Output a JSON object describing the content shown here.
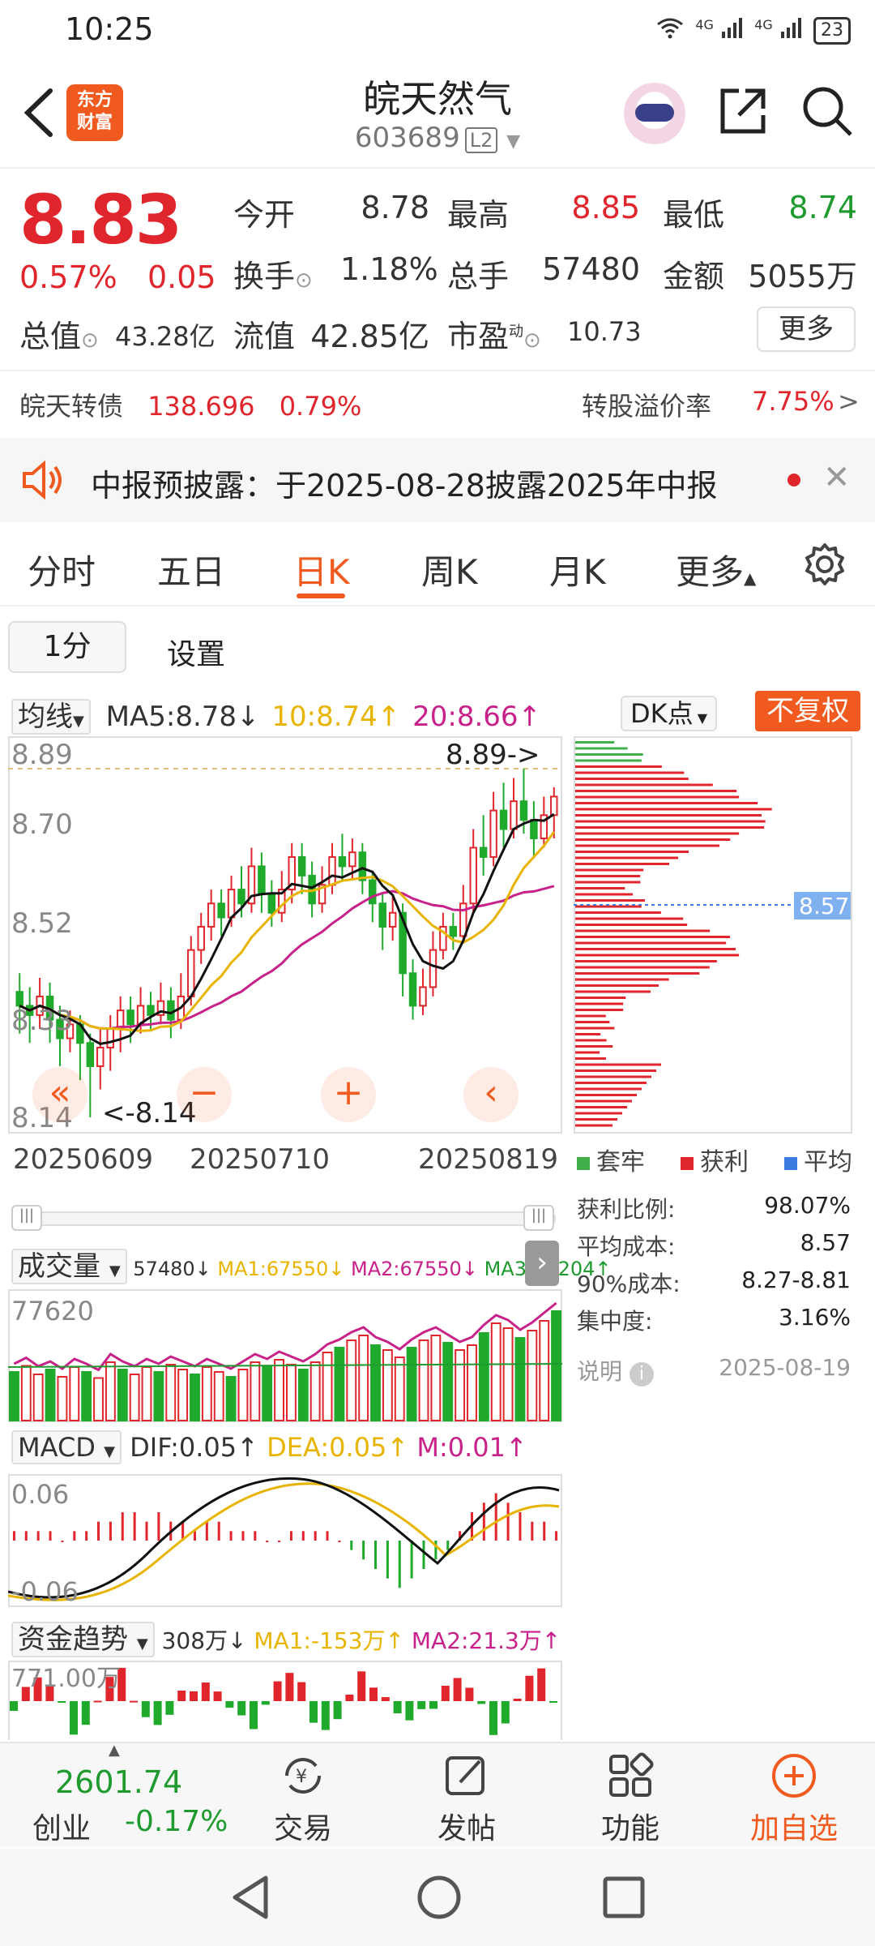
{
  "status": {
    "time": "10:25",
    "net1": "4G",
    "net2": "4G",
    "battery": "23"
  },
  "header": {
    "logo_line1": "东方",
    "logo_line2": "财富",
    "name": "皖天然气",
    "code": "603689",
    "level": "L2"
  },
  "quote": {
    "price": "8.83",
    "pct": "0.57%",
    "change": "0.05",
    "open_label": "今开",
    "open": "8.78",
    "high_label": "最高",
    "high": "8.85",
    "low_label": "最低",
    "low": "8.74",
    "turnover_label": "换手",
    "turnover": "1.18%",
    "volume_label": "总手",
    "volume": "57480",
    "amount_label": "金额",
    "amount": "5055万",
    "mktcap_label": "总值",
    "mktcap": "43.28亿",
    "float_label": "流值",
    "float": "42.85亿",
    "pe_label": "市盈",
    "pe_sup": "动",
    "pe": "10.73",
    "more": "更多"
  },
  "bond": {
    "name": "皖天转债",
    "price": "138.696",
    "pct": "0.79%",
    "premium_label": "转股溢价率",
    "premium": "7.75%"
  },
  "notice": {
    "text": "中报预披露：于2025-08-28披露2025年中报"
  },
  "tabs": [
    "分时",
    "五日",
    "日K",
    "周K",
    "月K",
    "更多"
  ],
  "subbar": {
    "period": "1分",
    "settings": "设置"
  },
  "kline": {
    "ma_selector": "均线",
    "ma5": "MA5:8.78",
    "ma10": "10:8.74",
    "ma20": "20:8.66",
    "dk": "DK点",
    "fq": "不复权",
    "y_labels": [
      "8.89",
      "8.70",
      "8.52",
      "8.33",
      "8.14"
    ],
    "high_mark": "8.89->",
    "low_mark": "<-8.14",
    "dates": [
      "20250609",
      "20250710",
      "20250819"
    ],
    "cost_tag": "8.57"
  },
  "chip": {
    "legend": [
      "套牢",
      "获利",
      "平均"
    ],
    "stats": [
      {
        "label": "获利比例:",
        "value": "98.07%"
      },
      {
        "label": "平均成本:",
        "value": "8.57"
      },
      {
        "label": "90%成本:",
        "value": "8.27-8.81"
      },
      {
        "label": "集中度:",
        "value": "3.16%"
      }
    ],
    "note": "说明",
    "date": "2025-08-19"
  },
  "volume": {
    "label": "成交量",
    "v": "57480",
    "ma1": "MA1:67550",
    "ma2": "MA2:67550",
    "ma3": "MA3:37204",
    "ylabel": "77620"
  },
  "macd": {
    "label": "MACD",
    "dif": "DIF:0.05",
    "dea": "DEA:0.05",
    "m": "M:0.01",
    "top": "0.06",
    "bottom": "-0.06"
  },
  "fund": {
    "label": "资金趋势",
    "v": "308万",
    "ma1": "MA1:-153万",
    "ma2": "MA2:21.3万",
    "ylabel": "771.00万"
  },
  "bottom": {
    "index_value": "2601.74",
    "index_name": "创业",
    "index_pct": "-0.17%",
    "trade": "交易",
    "post": "发帖",
    "func": "功能",
    "add": "加自选"
  },
  "chart_data": {
    "type": "candlestick",
    "ylim": [
      8.14,
      8.89
    ],
    "x_start": "20250609",
    "x_end": "20250819",
    "candles": [
      [
        8.41,
        8.38,
        8.45,
        8.32
      ],
      [
        8.38,
        8.36,
        8.42,
        8.3
      ],
      [
        8.36,
        8.4,
        8.44,
        8.33
      ],
      [
        8.4,
        8.35,
        8.43,
        8.3
      ],
      [
        8.35,
        8.31,
        8.38,
        8.25
      ],
      [
        8.31,
        8.34,
        8.37,
        8.28
      ],
      [
        8.34,
        8.3,
        8.36,
        8.22
      ],
      [
        8.3,
        8.25,
        8.32,
        8.14
      ],
      [
        8.25,
        8.29,
        8.33,
        8.2
      ],
      [
        8.29,
        8.33,
        8.36,
        8.24
      ],
      [
        8.33,
        8.37,
        8.4,
        8.28
      ],
      [
        8.37,
        8.34,
        8.4,
        8.3
      ],
      [
        8.34,
        8.38,
        8.42,
        8.32
      ],
      [
        8.38,
        8.36,
        8.41,
        8.33
      ],
      [
        8.36,
        8.39,
        8.43,
        8.34
      ],
      [
        8.39,
        8.35,
        8.42,
        8.31
      ],
      [
        8.35,
        8.4,
        8.45,
        8.33
      ],
      [
        8.4,
        8.5,
        8.53,
        8.38
      ],
      [
        8.5,
        8.55,
        8.58,
        8.47
      ],
      [
        8.55,
        8.6,
        8.63,
        8.52
      ],
      [
        8.6,
        8.57,
        8.63,
        8.53
      ],
      [
        8.57,
        8.63,
        8.66,
        8.55
      ],
      [
        8.63,
        8.6,
        8.68,
        8.57
      ],
      [
        8.6,
        8.68,
        8.72,
        8.58
      ],
      [
        8.68,
        8.62,
        8.71,
        8.58
      ],
      [
        8.62,
        8.58,
        8.65,
        8.55
      ],
      [
        8.58,
        8.63,
        8.67,
        8.56
      ],
      [
        8.63,
        8.7,
        8.73,
        8.6
      ],
      [
        8.7,
        8.66,
        8.73,
        8.62
      ],
      [
        8.66,
        8.6,
        8.69,
        8.57
      ],
      [
        8.6,
        8.64,
        8.68,
        8.58
      ],
      [
        8.64,
        8.7,
        8.73,
        8.62
      ],
      [
        8.7,
        8.68,
        8.75,
        8.65
      ],
      [
        8.68,
        8.71,
        8.74,
        8.65
      ],
      [
        8.71,
        8.65,
        8.73,
        8.62
      ],
      [
        8.65,
        8.6,
        8.67,
        8.56
      ],
      [
        8.6,
        8.55,
        8.62,
        8.5
      ],
      [
        8.55,
        8.58,
        8.62,
        8.52
      ],
      [
        8.58,
        8.45,
        8.6,
        8.4
      ],
      [
        8.45,
        8.38,
        8.48,
        8.35
      ],
      [
        8.38,
        8.42,
        8.46,
        8.36
      ],
      [
        8.42,
        8.5,
        8.54,
        8.4
      ],
      [
        8.5,
        8.55,
        8.58,
        8.48
      ],
      [
        8.55,
        8.53,
        8.58,
        8.5
      ],
      [
        8.53,
        8.6,
        8.64,
        8.52
      ],
      [
        8.6,
        8.72,
        8.76,
        8.58
      ],
      [
        8.72,
        8.7,
        8.79,
        8.66
      ],
      [
        8.7,
        8.8,
        8.84,
        8.68
      ],
      [
        8.8,
        8.76,
        8.86,
        8.72
      ],
      [
        8.76,
        8.82,
        8.87,
        8.74
      ],
      [
        8.82,
        8.78,
        8.89,
        8.75
      ],
      [
        8.78,
        8.74,
        8.82,
        8.7
      ],
      [
        8.74,
        8.79,
        8.83,
        8.72
      ],
      [
        8.79,
        8.83,
        8.85,
        8.74
      ]
    ],
    "macd_hist": [
      0.01,
      0.01,
      0.01,
      0.01,
      0.0,
      0.01,
      0.01,
      0.02,
      0.02,
      0.03,
      0.03,
      0.02,
      0.03,
      0.02,
      0.02,
      0.01,
      0.02,
      0.02,
      0.01,
      0.01,
      0.01,
      0.0,
      0.0,
      0.01,
      0.01,
      0.01,
      0.01,
      0.0,
      -0.01,
      -0.02,
      -0.03,
      -0.04,
      -0.05,
      -0.04,
      -0.03,
      -0.02,
      -0.01,
      0.01,
      0.03,
      0.04,
      0.05,
      0.04,
      0.03,
      0.02,
      0.02,
      0.01
    ],
    "volume": [
      40,
      45,
      38,
      42,
      36,
      44,
      40,
      35,
      48,
      42,
      38,
      44,
      40,
      46,
      42,
      38,
      44,
      40,
      36,
      42,
      48,
      44,
      50,
      46,
      42,
      48,
      56,
      60,
      66,
      70,
      62,
      58,
      52,
      60,
      66,
      70,
      64,
      58,
      62,
      72,
      80,
      76,
      68,
      74,
      82,
      90
    ]
  }
}
